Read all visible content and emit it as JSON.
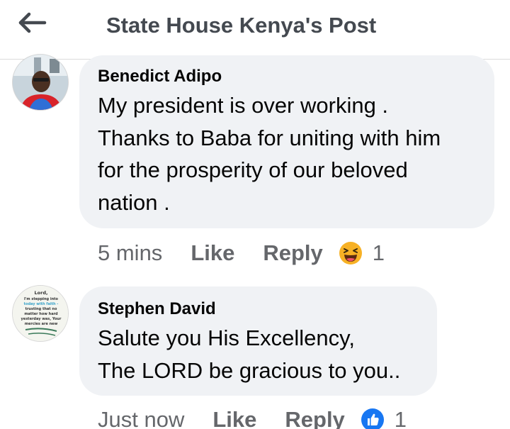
{
  "header": {
    "title": "State House Kenya's Post",
    "back_icon": "arrow-left-icon"
  },
  "colors": {
    "bubble_bg": "#f0f2f5",
    "meta_text": "#65676b",
    "title_text": "#444950",
    "like_reaction": "#1877f2",
    "haha_reaction": "#f7b125"
  },
  "comments": [
    {
      "author": "Benedict Adipo",
      "lines": [
        "My president is over working .",
        "Thanks to Baba for uniting with him",
        "for the prosperity of our beloved",
        "nation ."
      ],
      "time": "5 mins",
      "like_label": "Like",
      "reply_label": "Reply",
      "reaction_icon": "haha-emoji-icon",
      "reaction_count": "1"
    },
    {
      "author": "Stephen David",
      "lines": [
        "Salute you His Excellency,",
        "The LORD be gracious to you.."
      ],
      "time": "Just now",
      "like_label": "Like",
      "reply_label": "Reply",
      "reaction_icon": "thumbs-up-icon",
      "reaction_count": "1",
      "avatar_text": [
        "Lord,",
        "I'm stepping into",
        "today with faith -",
        "trusting that no",
        "matter how hard",
        "yesterday was, Your",
        "mercies are new"
      ]
    }
  ]
}
